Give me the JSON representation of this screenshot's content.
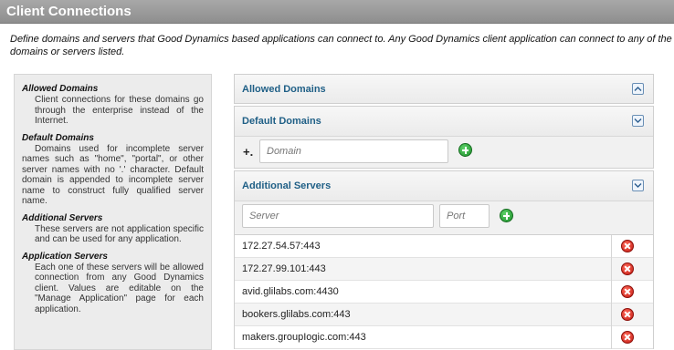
{
  "header": {
    "title": "Client Connections"
  },
  "intro": {
    "line1": "Define domains and servers that Good Dynamics based applications can connect to. Any Good Dynamics client application can connect to any of the",
    "line2": "domains or servers listed."
  },
  "help": {
    "allowed_title": "Allowed Domains",
    "allowed_body": "Client connections for these domains go through the enterprise instead of the Internet.",
    "default_title": "Default Domains",
    "default_body": "Domains used for incomplete server names such as \"home\", \"portal\", or other server names with no '.' character. Default domain is appended to incomplete server name to construct fully qualified server name.",
    "additional_title": "Additional Servers",
    "additional_body": "These servers are not application specific and can be used for any application.",
    "application_title": "Application Servers",
    "application_body": "Each one of these servers will be allowed connection from any Good Dynamics client. Values are editable on the \"Manage Application\" page for each application."
  },
  "panels": {
    "allowed": {
      "title": "Allowed Domains"
    },
    "default": {
      "title": "Default Domains",
      "prefix": "+.",
      "domain_placeholder": "Domain"
    },
    "additional": {
      "title": "Additional Servers",
      "server_placeholder": "Server",
      "port_placeholder": "Port"
    }
  },
  "servers": [
    "172.27.54.57:443",
    "172.27.99.101:443",
    "avid.glilabs.com:4430",
    "bookers.glilabs.com:443",
    "makers.groupIogic.com:443"
  ],
  "colors": {
    "accent": "#1f5f86",
    "add": "#1e8f2b",
    "delete": "#c21a12",
    "header": "#9a9a9a"
  }
}
